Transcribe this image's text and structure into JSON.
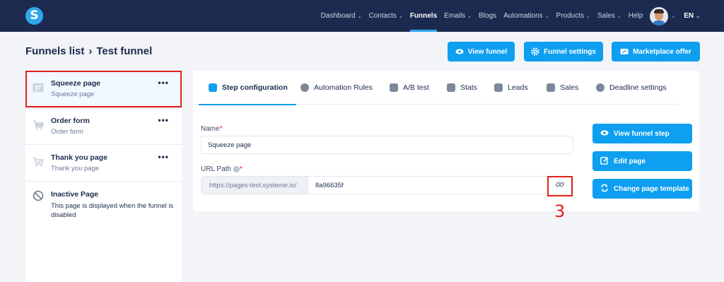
{
  "nav": {
    "logo_letter": "S",
    "items": [
      {
        "label": "Dashboard",
        "chevron": true
      },
      {
        "label": "Contacts",
        "chevron": true
      },
      {
        "label": "Funnels",
        "chevron": false,
        "active": true
      },
      {
        "label": "Emails",
        "chevron": true
      },
      {
        "label": "Blogs",
        "chevron": false
      },
      {
        "label": "Automations",
        "chevron": true
      },
      {
        "label": "Products",
        "chevron": true
      },
      {
        "label": "Sales",
        "chevron": true
      },
      {
        "label": "Help",
        "chevron": false
      }
    ],
    "language": "EN",
    "chevron_glyph": "⌄"
  },
  "header": {
    "breadcrumb_root": "Funnels list",
    "breadcrumb_sep": "›",
    "breadcrumb_current": "Test funnel",
    "buttons": {
      "view_funnel": "View funnel",
      "funnel_settings": "Funnel settings",
      "marketplace_offer": "Marketplace offer"
    }
  },
  "sidebar": {
    "steps": [
      {
        "title": "Squeeze page",
        "subtitle": "Squeeze page",
        "icon": "page-icon"
      },
      {
        "title": "Order form",
        "subtitle": "Order form",
        "icon": "cart-icon"
      },
      {
        "title": "Thank you page",
        "subtitle": "Thank you page",
        "icon": "cart-check-icon"
      },
      {
        "title": "Inactive Page",
        "subtitle": "This page is displayed when the funnel is disabled",
        "icon": "ban-icon"
      }
    ],
    "dots": "•••"
  },
  "tabs": [
    {
      "label": "Step configuration",
      "icon": "sliders-icon",
      "active": true
    },
    {
      "label": "Automation Rules",
      "icon": "bolt-icon"
    },
    {
      "label": "A/B test",
      "icon": "split-icon"
    },
    {
      "label": "Stats",
      "icon": "stats-icon"
    },
    {
      "label": "Leads",
      "icon": "users-icon"
    },
    {
      "label": "Sales",
      "icon": "dollar-icon"
    },
    {
      "label": "Deadline settings",
      "icon": "clock-icon"
    }
  ],
  "form": {
    "name_label": "Name",
    "required_mark": "*",
    "name_value": "Squeeze page",
    "url_label": "URL Path",
    "info_glyph": "i",
    "url_prefix": "https://pages-test.systeme.io/",
    "url_value": "8a96635f"
  },
  "actions": {
    "view_funnel_step": "View funnel step",
    "edit_page": "Edit page",
    "change_template": "Change page template"
  },
  "annotation": "3",
  "colors": {
    "nav_bg": "#1c2a4f",
    "accent": "#0e9ff0",
    "highlight": "#e2231a"
  }
}
